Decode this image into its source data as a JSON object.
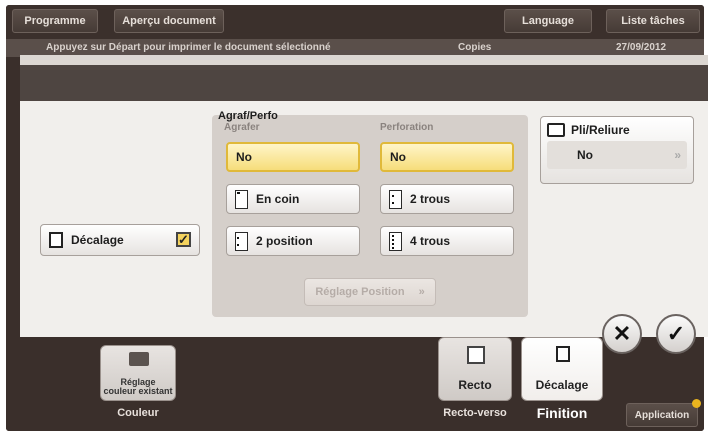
{
  "topbar": {
    "programme": "Programme",
    "apercu": "Aperçu document",
    "language": "Language",
    "liste_taches": "Liste tâches"
  },
  "infostrip": {
    "message": "Appuyez sur Départ pour imprimer le document sélectionné",
    "copies": "Copies",
    "date": "27/09/2012"
  },
  "dialog": {
    "decalage_label": "Décalage",
    "agraf_perfo_label": "Agraf/Perfo",
    "agrafer_label": "Agrafer",
    "perforation_label": "Perforation",
    "agrafer_options": [
      "No",
      "En coin",
      "2 position"
    ],
    "perforation_options": [
      "No",
      "2 trous",
      "4 trous"
    ],
    "reglage_position": "Réglage Position",
    "pli_reliure": {
      "title": "Pli/Reliure",
      "value": "No"
    }
  },
  "bottom": {
    "couleur_tile": "Réglage couleur existant",
    "couleur_label": "Couleur",
    "recto_tile": "Recto",
    "recto_verso_label": "Recto-verso",
    "decalage_tile": "Décalage",
    "finition_label": "Finition",
    "application": "Application"
  },
  "colors": {
    "selected": "#f6dd7a",
    "accent": "#e0b93a"
  }
}
